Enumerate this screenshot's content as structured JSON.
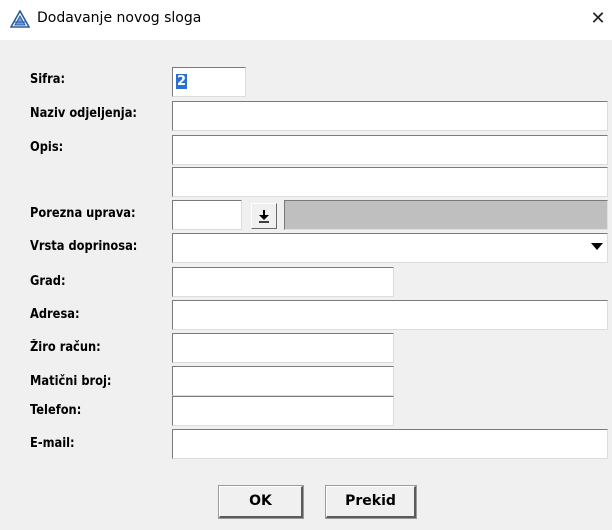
{
  "window": {
    "title": "Dodavanje novog sloga",
    "close_glyph": "✕"
  },
  "form": {
    "labels": {
      "sifra": "Sifra:",
      "naziv": "Naziv odjeljenja:",
      "opis": "Opis:",
      "porezna": "Porezna uprava:",
      "vrsta": "Vrsta doprinosa:",
      "grad": "Grad:",
      "adresa": "Adresa:",
      "ziro": "Žiro račun:",
      "maticni": "Matični broj:",
      "telefon": "Telefon:",
      "email": "E-mail:"
    },
    "values": {
      "sifra": "2",
      "naziv": "",
      "opis1": "",
      "opis2": "",
      "porezna": "",
      "vrsta": "",
      "grad": "",
      "adresa": "",
      "ziro": "",
      "maticni": "",
      "telefon": "",
      "email": ""
    },
    "lookup_glyph": "⭳"
  },
  "buttons": {
    "ok": "OK",
    "cancel": "Prekid"
  },
  "icons": {
    "app": "app-triangle-icon",
    "close": "close-icon",
    "lookup": "download-arrow-icon",
    "dropdown": "chevron-down-icon"
  }
}
